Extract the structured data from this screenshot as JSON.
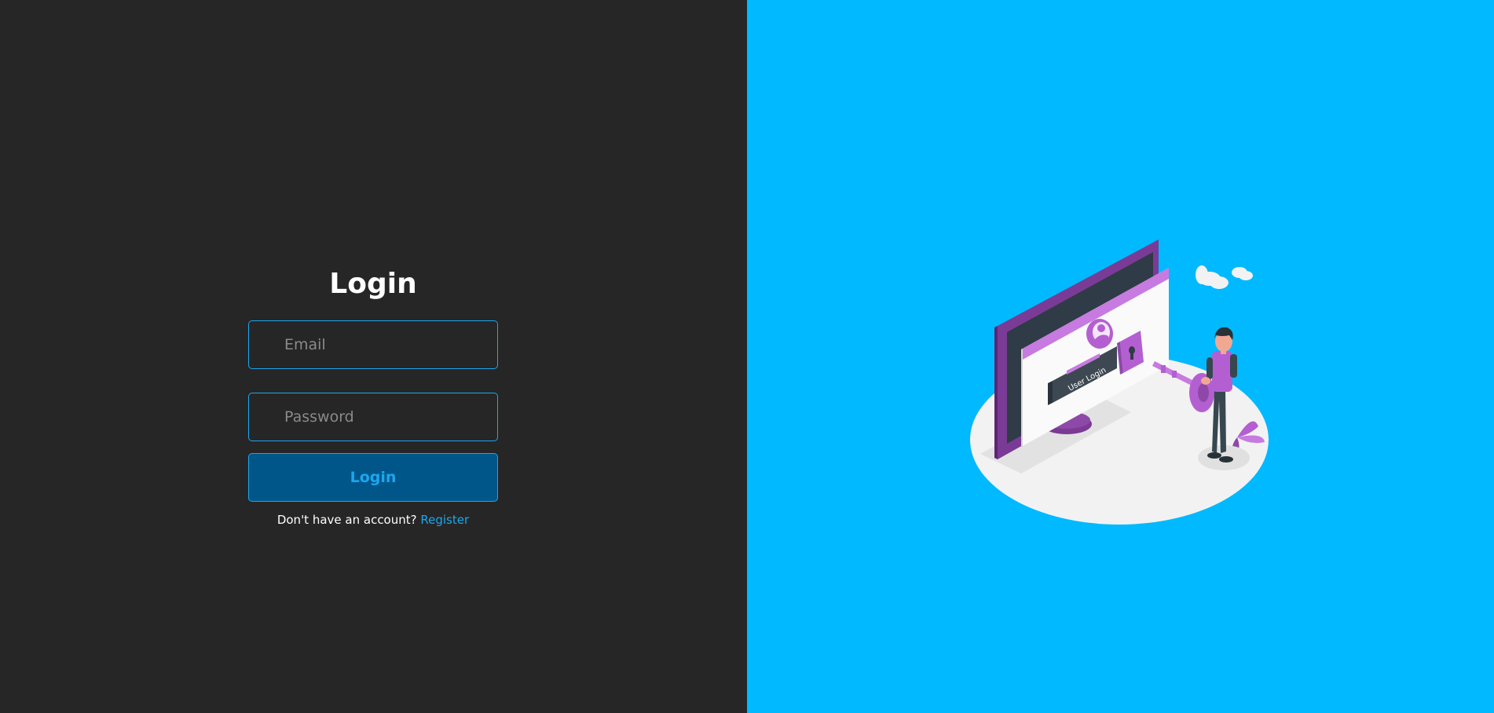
{
  "login": {
    "title": "Login",
    "email_placeholder": "Email",
    "password_placeholder": "Password",
    "submit_label": "Login",
    "register_prompt": "Don't have an account?",
    "register_link": "Register"
  },
  "illustration": {
    "screen_label": "User Login",
    "icons": [
      "monitor-icon",
      "user-icon",
      "padlock-icon",
      "key-icon",
      "cloud-icon",
      "plant-icon",
      "person-icon"
    ]
  },
  "colors": {
    "left_background": "#262626",
    "right_background": "#00b9ff",
    "accent": "#1aa7ef",
    "button_background": "#005689",
    "illustration_purple": "#b45fd1"
  }
}
